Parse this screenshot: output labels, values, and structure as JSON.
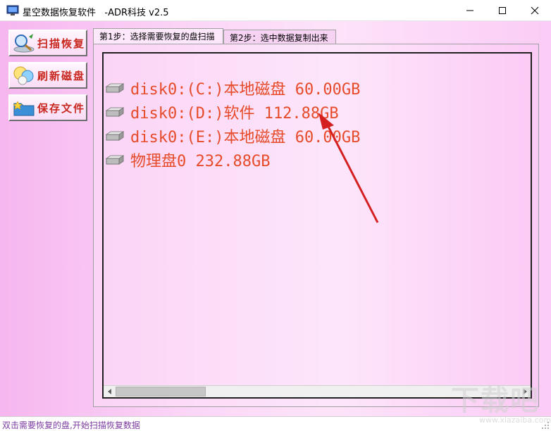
{
  "window": {
    "title": "星空数据恢复软件   -ADR科技 v2.5"
  },
  "sidebar": {
    "buttons": [
      {
        "label": "扫描恢复",
        "icon": "magnifier-disk-icon"
      },
      {
        "label": "刷新磁盘",
        "icon": "refresh-bubbles-icon"
      },
      {
        "label": "保存文件",
        "icon": "save-folder-icon"
      }
    ]
  },
  "tabs": [
    {
      "label": "第1步：选择需要恢复的盘扫描",
      "active": true
    },
    {
      "label": "第2步：选中数据复制出来",
      "active": false
    }
  ],
  "disks": [
    {
      "label": "disk0:(C:)本地磁盘 60.00GB"
    },
    {
      "label": "disk0:(D:)软件 112.88GB"
    },
    {
      "label": "disk0:(E:)本地磁盘 60.00GB"
    },
    {
      "label": "物理盘0 232.88GB"
    }
  ],
  "status": {
    "text": "双击需要恢复的盘,开始扫描恢复数据"
  },
  "watermark": {
    "text": "下载吧",
    "url": "www.xiazaiba.com"
  },
  "colors": {
    "accent_red": "#e64b2a",
    "button_text": "#c8281e",
    "annotation_arrow": "#d42020"
  }
}
